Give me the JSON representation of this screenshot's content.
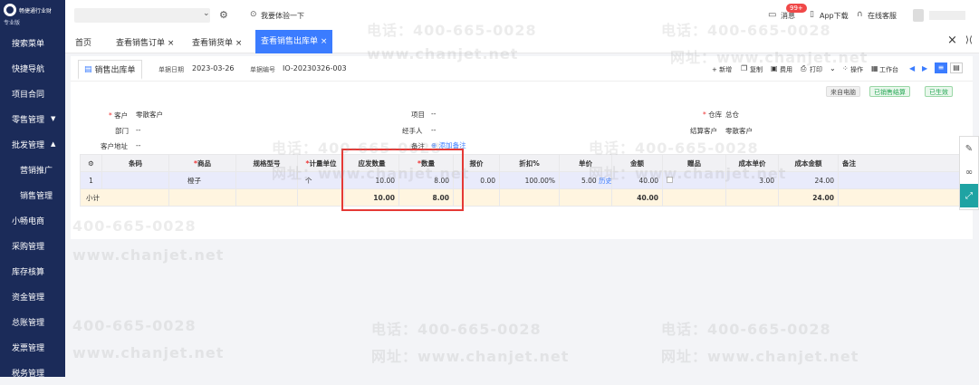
{
  "app": {
    "logo_text": "畅捷通行业财",
    "edition": "专业版"
  },
  "sidebar": {
    "items": [
      {
        "label": "搜索菜单"
      },
      {
        "label": "快捷导航"
      },
      {
        "label": "项目合同"
      },
      {
        "label": "零售管理",
        "caret": "▼"
      },
      {
        "label": "批发管理",
        "caret": "▲"
      },
      {
        "label": "营销推广"
      },
      {
        "label": "销售管理"
      },
      {
        "label": "小畅电商"
      },
      {
        "label": "采购管理"
      },
      {
        "label": "库存核算"
      },
      {
        "label": "资金管理"
      },
      {
        "label": "总账管理"
      },
      {
        "label": "发票管理"
      },
      {
        "label": "税务管理"
      }
    ]
  },
  "topbar": {
    "try_label": "我要体验一下",
    "notify_label": "消息",
    "notify_count": "99+",
    "app_download": "App下载",
    "online_service": "在线客服"
  },
  "tabs": [
    {
      "label": "首页"
    },
    {
      "label": "查看销售订单 ×"
    },
    {
      "label": "查看销货单 ×"
    },
    {
      "label": "查看销售出库单 ×"
    }
  ],
  "close_glyph": "×",
  "doc": {
    "title": "销售出库单",
    "date_label": "单据日期",
    "date_value": "2023-03-26",
    "no_label": "单据编号",
    "no_value": "IO-20230326-003",
    "actions": {
      "new": "+ 新增",
      "copy": "复制",
      "fee": "费用",
      "print": "打印",
      "ops": "操作",
      "workbench": "工作台"
    },
    "badges": {
      "source": "来自电脑",
      "settled": "已销售结算",
      "effective": "已生效"
    }
  },
  "form": {
    "customer_label": "客户",
    "customer_value": "零散客户",
    "dept_label": "部门",
    "dept_value": "--",
    "addr_label": "客户地址",
    "addr_value": "--",
    "project_label": "项目",
    "project_value": "--",
    "handler_label": "经手人",
    "handler_value": "--",
    "remark_label": "备注",
    "add_remark": "添加备注",
    "warehouse_label": "仓库",
    "warehouse_value": "总仓",
    "settle_label": "结算客户",
    "settle_value": "零散客户"
  },
  "table": {
    "headers": [
      "条码",
      "商品",
      "规格型号",
      "计量单位",
      "应发数量",
      "数量",
      "报价",
      "折扣%",
      "单价",
      "金额",
      "赠品",
      "成本单价",
      "成本金额",
      "备注"
    ],
    "rows": [
      {
        "index": "1",
        "barcode": "",
        "product": "橙子",
        "spec": "",
        "unit": "个",
        "due_qty": "10.00",
        "qty": "8.00",
        "quote": "0.00",
        "discount": "100.00%",
        "price": "5.00",
        "history": "历史",
        "amount": "40.00",
        "gift": "",
        "cost_price": "3.00",
        "cost_amount": "24.00",
        "remark": ""
      }
    ],
    "subtotal": {
      "label": "小计",
      "due_qty": "10.00",
      "qty": "8.00",
      "amount": "40.00",
      "cost_amount": "24.00"
    }
  },
  "watermark": {
    "phone": "电话：400-665-0028",
    "phone_short": "400-665-0028",
    "site": "网址：www.chanjet.net",
    "site_short": "www.chanjet.net"
  },
  "colors": {
    "sidebar": "#1b2b59",
    "accent": "#3b7cff",
    "highlight": "#e53935",
    "success": "#22a652"
  }
}
